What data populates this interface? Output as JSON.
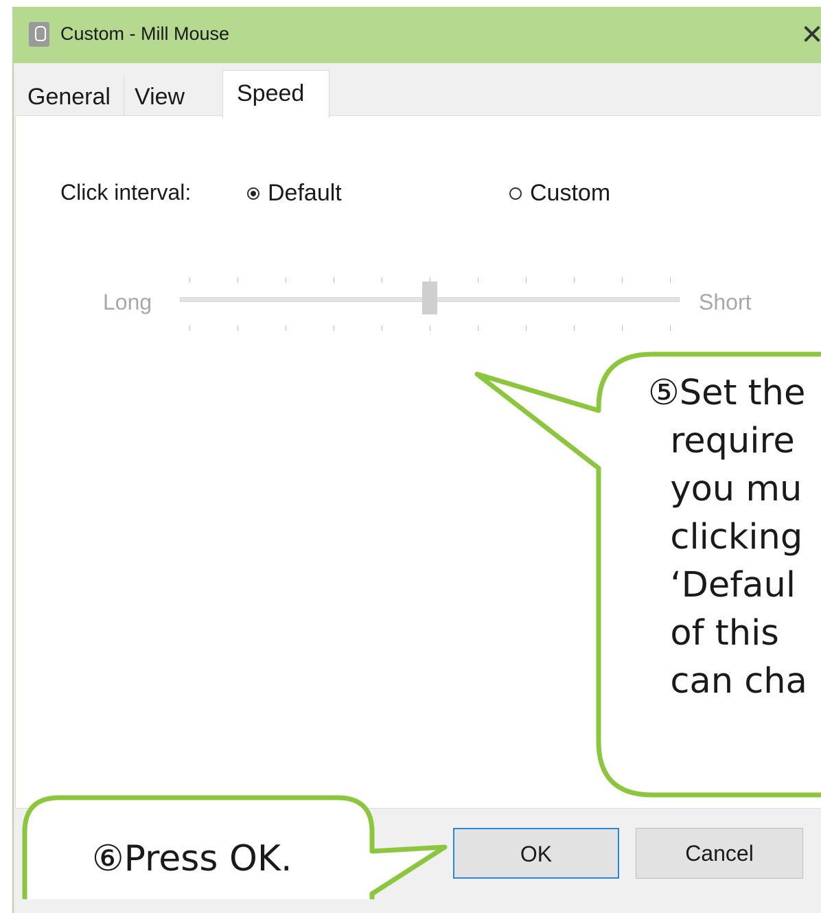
{
  "window": {
    "title": "Custom - Mill Mouse",
    "close_glyph": "✕",
    "app_icon": "mouse-icon"
  },
  "tabs": [
    {
      "label": "General",
      "selected": false
    },
    {
      "label": "View",
      "selected": false
    },
    {
      "label": "Speed",
      "selected": true
    }
  ],
  "speed": {
    "click_interval_label": "Click interval:",
    "options": [
      {
        "label": "Default",
        "selected": true
      },
      {
        "label": "Custom",
        "selected": false
      }
    ],
    "slider": {
      "left_label": "Long",
      "right_label": "Short",
      "ticks": 11,
      "value_fraction": 0.5,
      "enabled": false
    }
  },
  "buttons": {
    "ok": "OK",
    "cancel": "Cancel"
  },
  "callouts": {
    "step5": "⑤Set the\n  require\n  you mu\n  clicking\n  ‘Defaul\n  of this\n  can cha",
    "step6": "⑥Press OK."
  },
  "colors": {
    "titlebar": "#b4d98f",
    "callout_border": "#8cc63f",
    "ok_border": "#2a86d6"
  }
}
